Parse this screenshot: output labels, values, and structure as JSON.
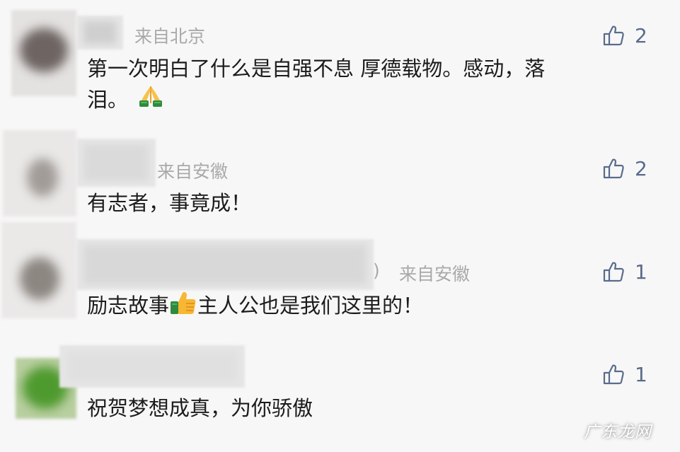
{
  "comments": [
    {
      "location": "来自北京",
      "text_line1": "第一次明白了什么是自强不息 厚德载物。感动，落",
      "text_line2": "泪。",
      "emoji": "folded-hands",
      "likes": "2"
    },
    {
      "location": "来自安徽",
      "text_line1": "有志者，事竟成！",
      "likes": "2"
    },
    {
      "location_prefix": ")",
      "location": "来自安徽",
      "text_before_emoji": "励志故事",
      "emoji": "thumbs-up",
      "text_after_emoji": "主人公也是我们这里的！",
      "likes": "1"
    },
    {
      "text_line1": "祝贺梦想成真，为你骄傲",
      "likes": "1"
    }
  ],
  "icons": {
    "like": "thumbs-up-outline-icon"
  },
  "colors": {
    "background": "#f7f7f7",
    "like_color": "#5a6b8c",
    "location_color": "#a9a9a9"
  },
  "watermark": "广东龙网"
}
